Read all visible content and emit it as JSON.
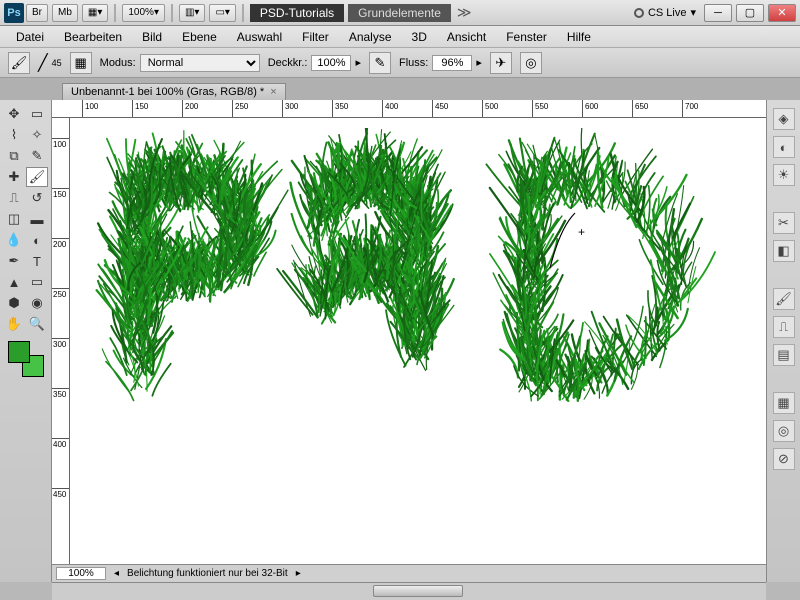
{
  "titlebar": {
    "app": "Ps",
    "br": "Br",
    "mb": "Mb",
    "zoom": "100%",
    "tab_active": "PSD-Tutorials",
    "tab_other": "Grundelemente",
    "cslive": "CS Live"
  },
  "menu": [
    "Datei",
    "Bearbeiten",
    "Bild",
    "Ebene",
    "Auswahl",
    "Filter",
    "Analyse",
    "3D",
    "Ansicht",
    "Fenster",
    "Hilfe"
  ],
  "options": {
    "brush_size": "45",
    "mode_label": "Modus:",
    "mode_value": "Normal",
    "opacity_label": "Deckkr.:",
    "opacity_value": "100%",
    "flow_label": "Fluss:",
    "flow_value": "96%"
  },
  "doc": {
    "title": "Unbenannt-1 bei 100% (Gras, RGB/8) *"
  },
  "swatch": {
    "fg": "#2a9d2a",
    "bg": "#46c246"
  },
  "ruler_h": [
    100,
    150,
    200,
    250,
    300,
    350,
    400,
    450,
    500,
    550,
    600,
    650,
    700
  ],
  "ruler_v": [
    100,
    150,
    200,
    250,
    300,
    350,
    400,
    450
  ],
  "status": {
    "zoom": "100%",
    "info": "Belichtung funktioniert nur bei 32-Bit"
  },
  "canvas_text": "PSD",
  "grass_color": "#2fa82f"
}
